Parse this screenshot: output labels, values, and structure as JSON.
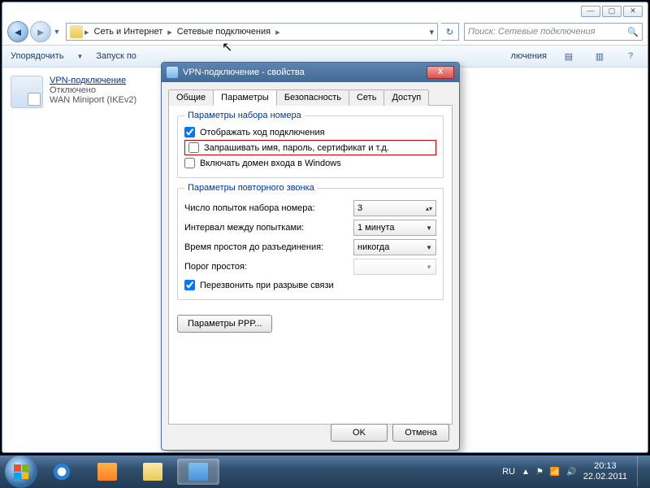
{
  "explorer": {
    "breadcrumb": [
      "Сеть и Интернет",
      "Сетевые подключения"
    ],
    "search_placeholder": "Поиск: Сетевые подключения",
    "toolbar": {
      "organize": "Упорядочить",
      "start": "Запуск по",
      "connect_end": "лючения"
    },
    "item": {
      "name": "VPN-подключение",
      "status": "Отключено",
      "sub": "WAN Miniport (IKEv2)"
    }
  },
  "dialog": {
    "title": "VPN-подключение - свойства",
    "tabs": [
      "Общие",
      "Параметры",
      "Безопасность",
      "Сеть",
      "Доступ"
    ],
    "group1_title": "Параметры набора номера",
    "chk_show_progress": "Отображать ход подключения",
    "chk_prompt": "Запрашивать имя, пароль, сертификат и т.д.",
    "chk_domain": "Включать домен входа в Windows",
    "group2_title": "Параметры повторного звонка",
    "row_attempts_lbl": "Число попыток набора номера:",
    "row_attempts_val": "3",
    "row_interval_lbl": "Интервал между попытками:",
    "row_interval_val": "1 минута",
    "row_idle_lbl": "Время простоя до разъединения:",
    "row_idle_val": "никогда",
    "row_threshold_lbl": "Порог простоя:",
    "row_threshold_val": "",
    "chk_redial": "Перезвонить при разрыве связи",
    "btn_ppp": "Параметры PPP...",
    "btn_ok": "OK",
    "btn_cancel": "Отмена"
  },
  "taskbar": {
    "lang": "RU",
    "time": "20:13",
    "date": "22.02.2011"
  }
}
